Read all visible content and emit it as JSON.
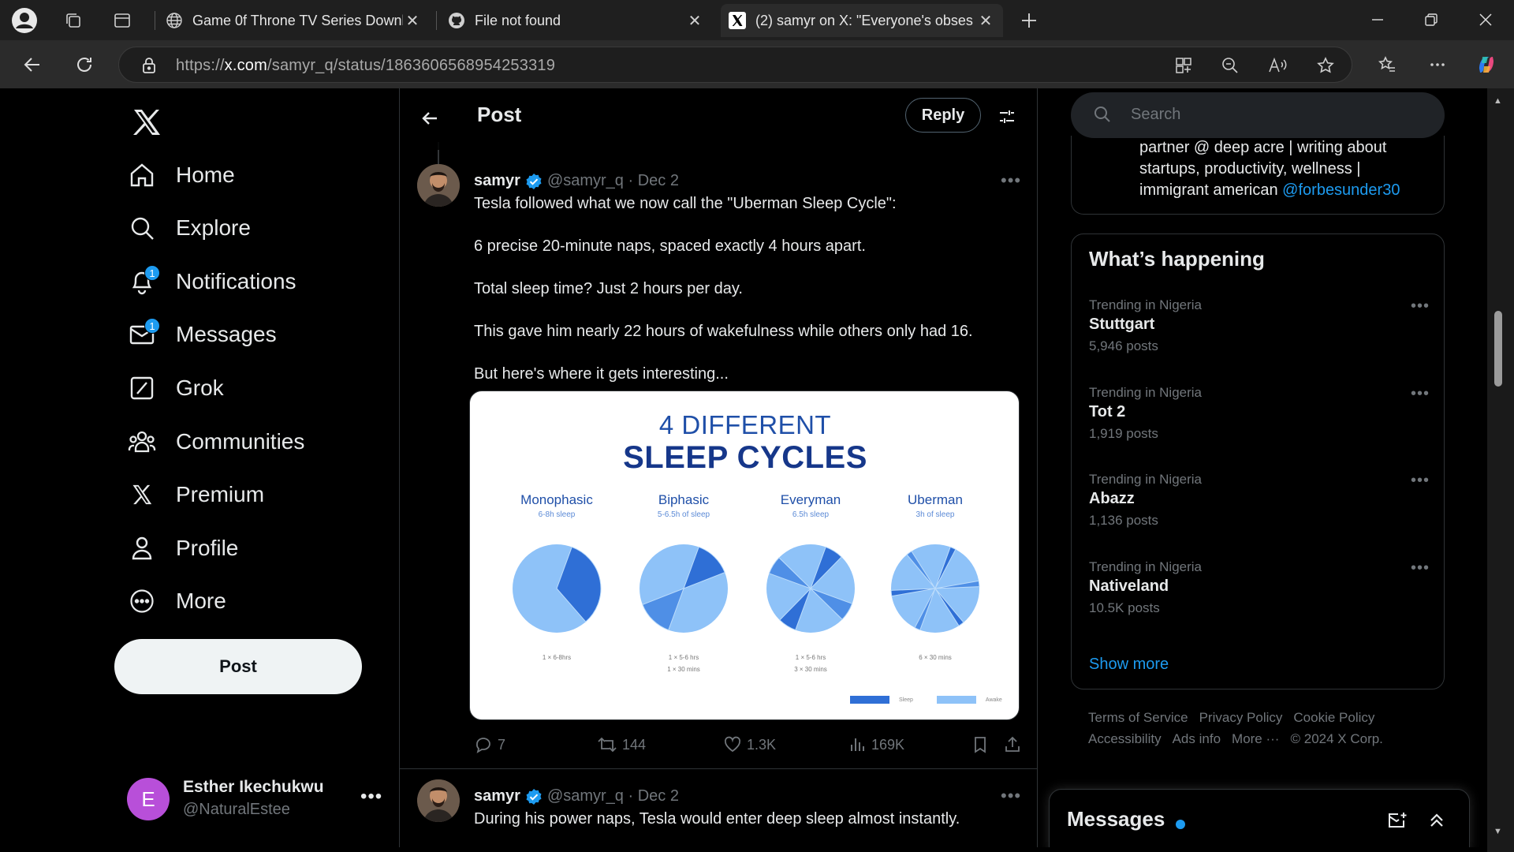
{
  "browser": {
    "tabs": [
      {
        "title": "Game 0f Throne TV Series Downlo",
        "icon": "globe-icon"
      },
      {
        "title": "File not found",
        "icon": "github-icon"
      },
      {
        "title": "(2) samyr on X: \"Everyone's obses",
        "icon": "x-logo-icon"
      }
    ],
    "url_prefix": "https://",
    "url_domain": "x.com",
    "url_path": "/samyr_q/status/1863606568954253319"
  },
  "nav": {
    "items": [
      {
        "label": "Home",
        "icon": "home-icon"
      },
      {
        "label": "Explore",
        "icon": "search-icon"
      },
      {
        "label": "Notifications",
        "icon": "bell-icon",
        "badge": "1"
      },
      {
        "label": "Messages",
        "icon": "mail-icon",
        "badge": "1"
      },
      {
        "label": "Grok",
        "icon": "grok-icon"
      },
      {
        "label": "Communities",
        "icon": "communities-icon"
      },
      {
        "label": "Premium",
        "icon": "x-logo-icon"
      },
      {
        "label": "Profile",
        "icon": "profile-icon"
      },
      {
        "label": "More",
        "icon": "more-circle-icon"
      }
    ],
    "post_label": "Post",
    "account": {
      "initial": "E",
      "name": "Esther Ikechukwu",
      "handle": "@NaturalEstee"
    }
  },
  "header": {
    "title": "Post",
    "reply_label": "Reply"
  },
  "tweet1": {
    "name": "samyr",
    "meta": "@samyr_q · Dec 2",
    "lines": [
      "Tesla followed what we now call the \"Uberman Sleep Cycle\":",
      "6 precise 20-minute naps, spaced exactly 4 hours apart.",
      "Total sleep time? Just 2 hours per day.",
      "This gave him nearly 22 hours of wakefulness while others only had 16.",
      "But here's where it gets interesting..."
    ],
    "stats": {
      "replies": "7",
      "reposts": "144",
      "likes": "1.3K",
      "views": "169K"
    }
  },
  "tweet2": {
    "name": "samyr",
    "meta": "@samyr_q · Dec 2",
    "text": "During his power naps, Tesla would enter deep sleep almost instantly."
  },
  "chart_data": {
    "type": "pie",
    "title": "4 DIFFERENT",
    "subtitle": "SLEEP CYCLES",
    "charts": [
      {
        "name": "Monophasic",
        "sub": "6-8h sleep",
        "note": [
          "1 × 6-8hrs"
        ],
        "sleep_fraction": 0.33,
        "segments": 1
      },
      {
        "name": "Biphasic",
        "sub": "5-6.5h of sleep",
        "note": [
          "1 × 5-6 hrs",
          "1 × 30 mins"
        ],
        "sleep_fraction": 0.27,
        "segments": 2
      },
      {
        "name": "Everyman",
        "sub": "6.5h sleep",
        "note": [
          "1 × 5-6 hrs",
          "3 × 30 mins"
        ],
        "sleep_fraction": 0.27,
        "segments": 4
      },
      {
        "name": "Uberman",
        "sub": "3h of sleep",
        "note": [
          "6 × 30 mins"
        ],
        "sleep_fraction": 0.125,
        "segments": 6
      }
    ],
    "legend": [
      "Sleep",
      "Awake"
    ],
    "colors": {
      "sleep": "#2f6fd6",
      "awake": "#8ec2f8",
      "light": "#bcdcfb"
    }
  },
  "search": {
    "placeholder": "Search"
  },
  "bio": {
    "lines": [
      "partner @ deep acre | writing about",
      "startups, productivity, wellness |"
    ],
    "line3_text": "immigrant american ",
    "mention": "@forbesunder30"
  },
  "happening": {
    "title": "What’s happening",
    "trends": [
      {
        "context": "Trending in Nigeria",
        "name": "Stuttgart",
        "count": "5,946 posts"
      },
      {
        "context": "Trending in Nigeria",
        "name": "Tot 2",
        "count": "1,919 posts"
      },
      {
        "context": "Trending in Nigeria",
        "name": "Abazz",
        "count": "1,136 posts"
      },
      {
        "context": "Trending in Nigeria",
        "name": "Nativeland",
        "count": "10.5K posts"
      }
    ],
    "show_more": "Show more"
  },
  "footer": {
    "links": [
      "Terms of Service",
      "Privacy Policy",
      "Cookie Policy",
      "Accessibility",
      "Ads info",
      "More ···",
      "© 2024 X Corp."
    ]
  },
  "messages_dock": {
    "title": "Messages"
  },
  "colors": {
    "accent": "#1d9bf0",
    "background": "#000000",
    "text": "#e7e9ea",
    "muted": "#71767b"
  }
}
